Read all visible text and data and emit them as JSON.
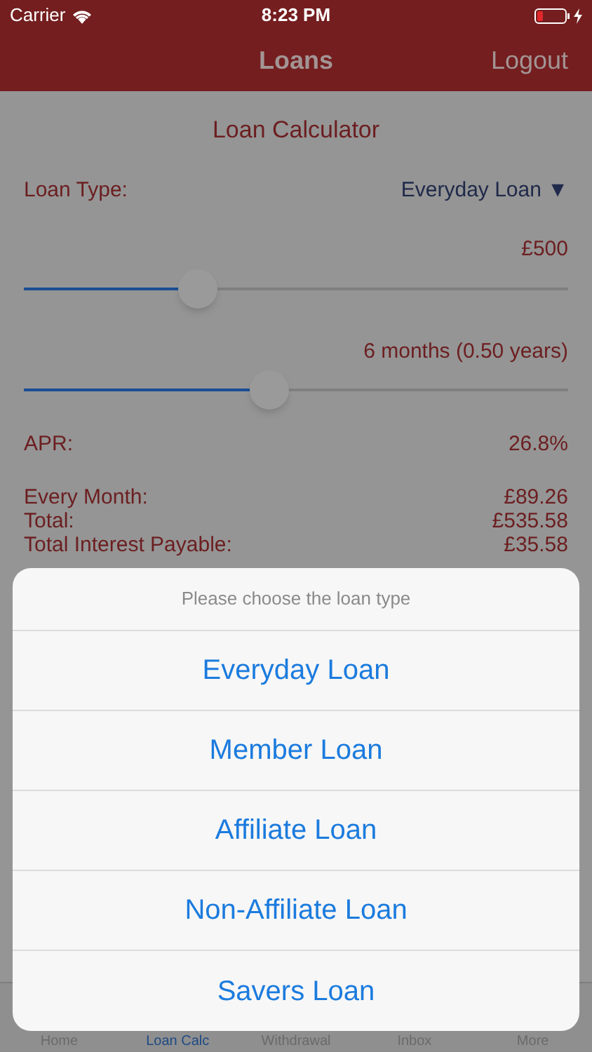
{
  "status_bar": {
    "carrier": "Carrier",
    "time": "8:23 PM"
  },
  "nav_bar": {
    "title": "Loans",
    "action": "Logout"
  },
  "calculator": {
    "title": "Loan Calculator",
    "loan_type_label": "Loan Type:",
    "loan_type_value": "Everyday Loan",
    "dropdown_glyph": "▼",
    "sliders": [
      {
        "reading": "£500",
        "level": 0.32
      },
      {
        "reading": "6 months (0.50 years)",
        "level": 0.45
      }
    ],
    "apr": {
      "label": "APR:",
      "value": "26.8%"
    },
    "results": [
      {
        "label": "Every Month:",
        "value": "£89.26"
      },
      {
        "label": "Total:",
        "value": "£535.58"
      },
      {
        "label": "Total Interest Payable:",
        "value": "£35.58"
      }
    ]
  },
  "action_sheet": {
    "title": "Please choose the loan type",
    "options": [
      "Everyday Loan",
      "Member Loan",
      "Affiliate Loan",
      "Non-Affiliate Loan",
      "Savers Loan"
    ]
  },
  "tab_bar": {
    "items": [
      {
        "label": "Home",
        "selected": false
      },
      {
        "label": "Loan Calc",
        "selected": true
      },
      {
        "label": "Withdrawal",
        "selected": false
      },
      {
        "label": "Inbox",
        "selected": false
      },
      {
        "label": "More",
        "selected": false
      }
    ]
  }
}
